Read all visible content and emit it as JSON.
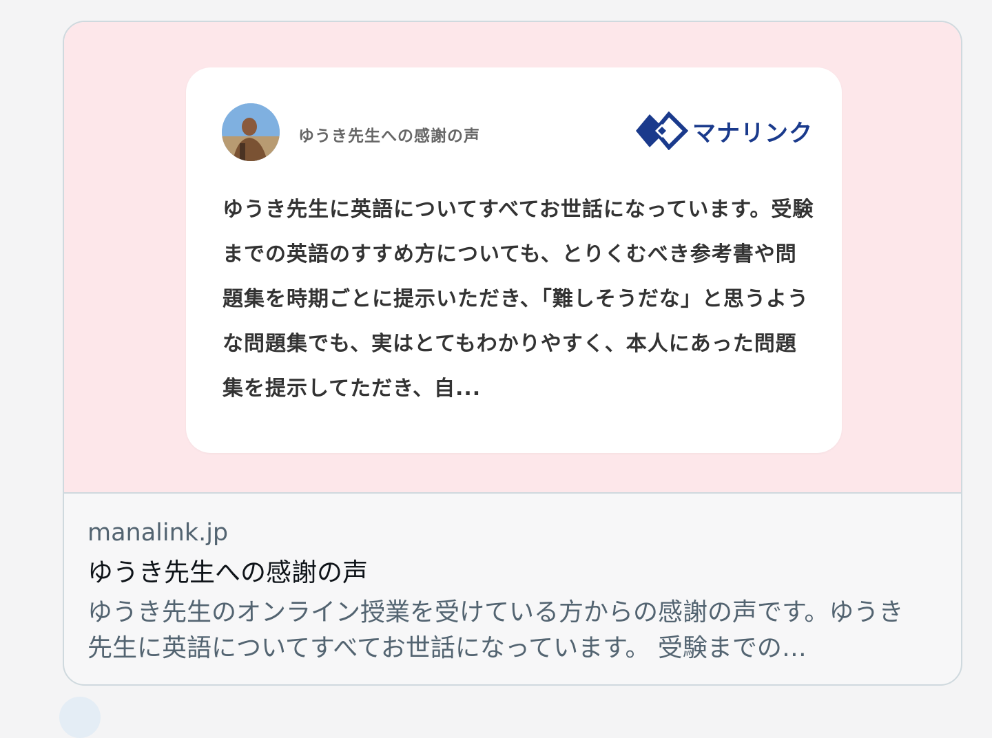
{
  "card": {
    "domain": "manalink.jp",
    "title": "ゆうき先生への感謝の声",
    "description": "ゆうき先生のオンライン授業を受けている方からの感謝の声です。ゆうき先生に英語についてすべてお世話になっています。 受験までの…"
  },
  "preview": {
    "header_title": "ゆうき先生への感謝の声",
    "brand_name": "マナリンク",
    "brand_color": "#1a3a8c",
    "background_color": "#fde7ea",
    "testimonial": "ゆうき先生に英語についてすべてお世話になっています。受験までの英語のすすめ方についても、とりくむべき参考書や問題集を時期ごとに提示いただき、「難しそうだな」と思うような問題集でも、実はとてもわかりやすく、本人にあった問題集を提示してただき、自..."
  }
}
